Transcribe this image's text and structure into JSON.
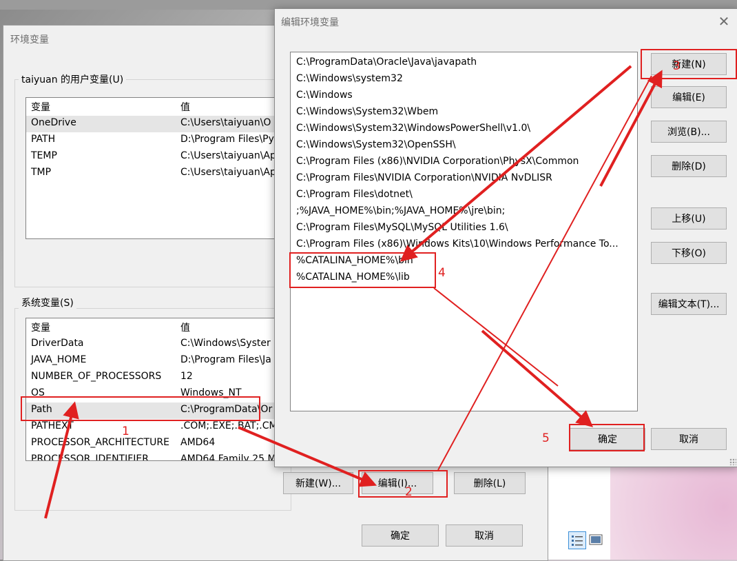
{
  "env_window": {
    "title": "环境变量",
    "user_group": {
      "label": "taiyuan 的用户变量(U)",
      "headers": [
        "变量",
        "值"
      ],
      "rows": [
        [
          "OneDrive",
          "C:\\Users\\taiyuan\\O"
        ],
        [
          "PATH",
          "D:\\Program Files\\Py"
        ],
        [
          "TEMP",
          "C:\\Users\\taiyuan\\Ap"
        ],
        [
          "TMP",
          "C:\\Users\\taiyuan\\Ap"
        ]
      ]
    },
    "system_group": {
      "label": "系统变量(S)",
      "headers": [
        "变量",
        "值"
      ],
      "rows": [
        [
          "DriverData",
          "C:\\Windows\\Syster"
        ],
        [
          "JAVA_HOME",
          "D:\\Program Files\\Ja"
        ],
        [
          "NUMBER_OF_PROCESSORS",
          "12"
        ],
        [
          "OS",
          "Windows_NT"
        ],
        [
          "Path",
          "C:\\ProgramData\\Or"
        ],
        [
          "PATHEXT",
          ".COM;.EXE;.BAT;.CM"
        ],
        [
          "PROCESSOR_ARCHITECTURE",
          "AMD64"
        ],
        [
          "PROCESSOR_IDENTIFIER",
          "AMD64 Family 25 M"
        ]
      ],
      "buttons": {
        "new": "新建(W)...",
        "edit": "编辑(I)...",
        "delete": "删除(L)"
      }
    },
    "ok": "确定",
    "cancel": "取消"
  },
  "edit_dialog": {
    "title": "编辑环境变量",
    "paths": [
      "C:\\ProgramData\\Oracle\\Java\\javapath",
      "C:\\Windows\\system32",
      "C:\\Windows",
      "C:\\Windows\\System32\\Wbem",
      "C:\\Windows\\System32\\WindowsPowerShell\\v1.0\\",
      "C:\\Windows\\System32\\OpenSSH\\",
      "C:\\Program Files (x86)\\NVIDIA Corporation\\PhysX\\Common",
      "C:\\Program Files\\NVIDIA Corporation\\NVIDIA NvDLISR",
      "C:\\Program Files\\dotnet\\",
      ";%JAVA_HOME%\\bin;%JAVA_HOME%\\jre\\bin;",
      "C:\\Program Files\\MySQL\\MySQL Utilities 1.6\\",
      "C:\\Program Files (x86)\\Windows Kits\\10\\Windows Performance To...",
      "%CATALINA_HOME%\\bin",
      "%CATALINA_HOME%\\lib"
    ],
    "buttons": {
      "new": "新建(N)",
      "edit": "编辑(E)",
      "browse": "浏览(B)...",
      "delete": "删除(D)",
      "move_up": "上移(U)",
      "move_down": "下移(O)",
      "edit_text": "编辑文本(T)..."
    },
    "ok": "确定",
    "cancel": "取消"
  },
  "annotations": [
    "1",
    "2",
    "3",
    "4",
    "5"
  ],
  "annotation_color": "#e02020"
}
